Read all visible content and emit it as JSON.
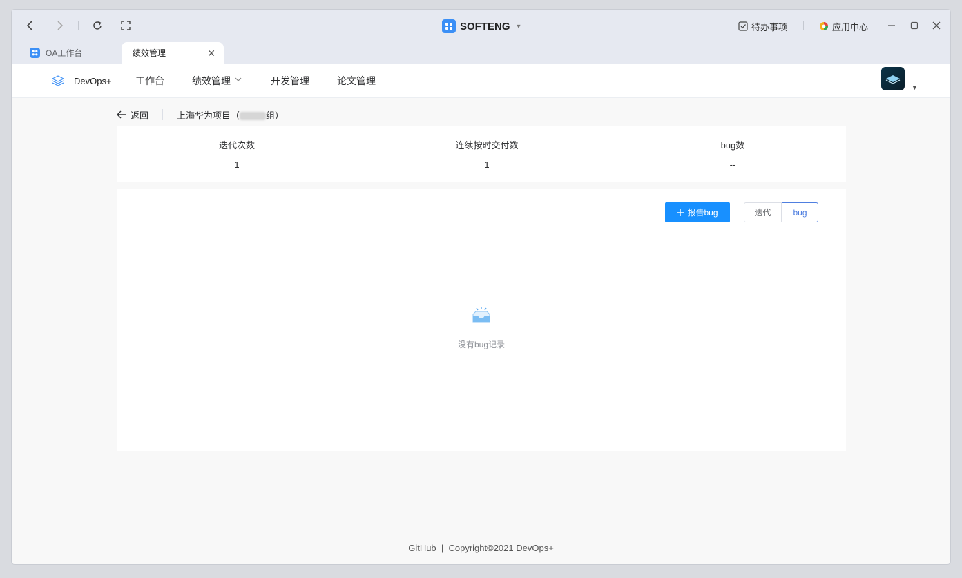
{
  "titlebar": {
    "app_name": "SOFTENG",
    "todo_label": "待办事项",
    "app_center_label": "应用中心"
  },
  "tabs": [
    {
      "label": "OA工作台",
      "active": false
    },
    {
      "label": "绩效管理",
      "active": true
    }
  ],
  "nav": {
    "brand": "DevOps+",
    "menu": [
      "工作台",
      "绩效管理",
      "开发管理",
      "论文管理"
    ]
  },
  "breadcrumb": {
    "back_label": "返回",
    "project_prefix": "上海华为项目（",
    "project_suffix": "组）"
  },
  "stats": [
    {
      "label": "迭代次数",
      "value": "1"
    },
    {
      "label": "连续按时交付数",
      "value": "1"
    },
    {
      "label": "bug数",
      "value": "--"
    }
  ],
  "actions": {
    "report_bug": "报告bug",
    "seg_iteration": "迭代",
    "seg_bug": "bug"
  },
  "empty_text": "没有bug记录",
  "footer": "GitHub  |  Copyright©2021 DevOps+",
  "colors": {
    "accent": "#1890ff",
    "titlebar_bg": "#e6e9f1",
    "seg_selected": "#4f7fe0"
  }
}
